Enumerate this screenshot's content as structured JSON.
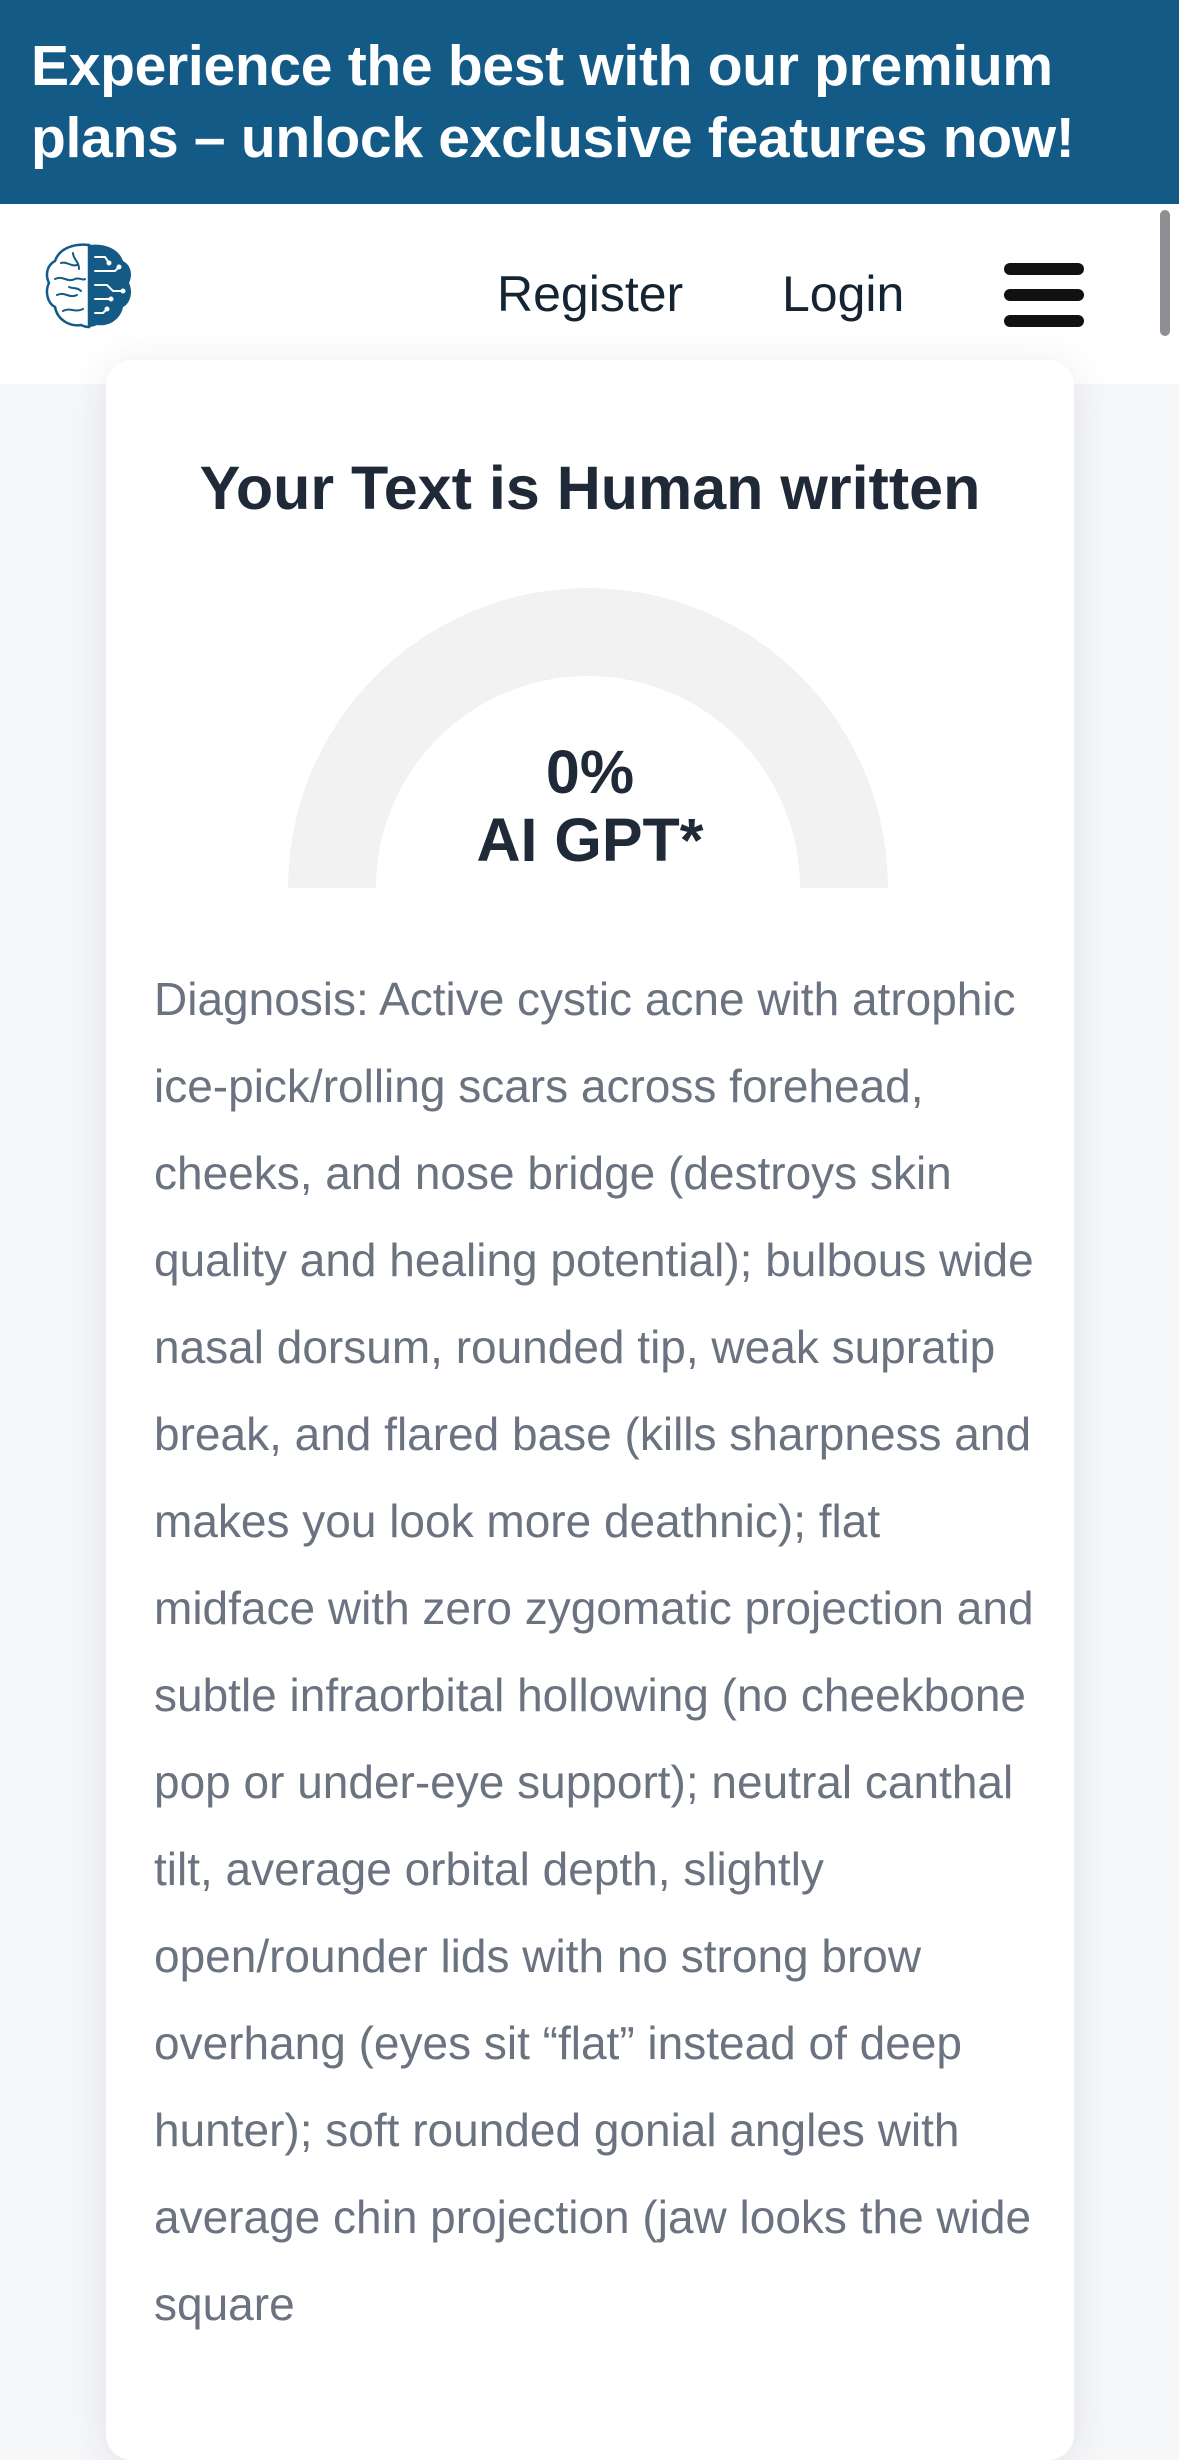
{
  "banner": {
    "text": "Experience the best with our premium plans – unlock exclusive features now!"
  },
  "nav": {
    "logo_icon": "brain-icon",
    "register_label": "Register",
    "login_label": "Login",
    "menu_icon": "hamburger-menu-icon"
  },
  "result": {
    "title": "Your Text is Human written",
    "ai_percentage": 0,
    "percent_text": "0%",
    "ai_label": "AI GPT*",
    "gauge_track_color": "#f2f2f2",
    "gauge_fill_color": "#145a87",
    "body": "Diagnosis: Active cystic acne with atrophic ice-pick/rolling scars across forehead, cheeks, and nose bridge (destroys skin quality and healing potential); bulbous wide nasal dorsum, rounded tip, weak supratip break, and flared base (kills sharpness and makes you look more deathnic); flat midface with zero zygomatic projection and subtle infraorbital hollowing (no cheekbone pop or under-eye support); neutral canthal tilt, average orbital depth, slightly open/rounder lids with no strong brow overhang (eyes sit “flat” instead of deep hunter); soft rounded gonial angles with average chin projection (jaw looks the wide square"
  },
  "colors": {
    "banner_bg": "#145a87",
    "page_bg": "#f6f7f9",
    "title_text": "#1f2937",
    "body_text": "#6b7280"
  }
}
